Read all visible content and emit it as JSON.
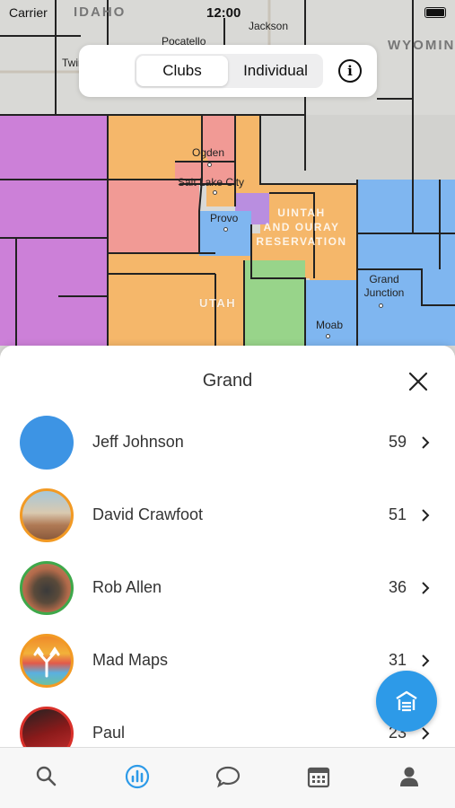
{
  "status_bar": {
    "carrier": "Carrier",
    "time": "12:00"
  },
  "map": {
    "state_labels": {
      "idaho": "IDAHO",
      "wyoming": "WYOMIN",
      "utah": "UTAH"
    },
    "reservation_label": [
      "UINTAH",
      "AND OURAY",
      "RESERVATION"
    ],
    "cities": [
      "Jackson",
      "Pocatello",
      "Twin",
      "Ogden",
      "Salt Lake City",
      "Provo",
      "Grand Junction",
      "Moab"
    ],
    "region_colors": {
      "purple": "#cc80d8",
      "orange": "#f5b76a",
      "red": "#f19a95",
      "blue": "#7fb6f0",
      "green": "#98d48a",
      "violet": "#b98ee0"
    }
  },
  "segmented_control": {
    "options": [
      "Clubs",
      "Individual"
    ],
    "selected": "Clubs",
    "info_icon": "info-icon"
  },
  "sheet": {
    "title": "Grand",
    "close_icon": "close-icon",
    "rows": [
      {
        "name": "Jeff Johnson",
        "score": "59",
        "avatar_color": "#3d94e4"
      },
      {
        "name": "David Crawfoot",
        "score": "51",
        "avatar_color": "#f29a24"
      },
      {
        "name": "Rob Allen",
        "score": "36",
        "avatar_color": "#3ea84a"
      },
      {
        "name": "Mad Maps",
        "score": "31",
        "avatar_color": "#f29a24"
      },
      {
        "name": "Paul",
        "score": "23",
        "avatar_color": "#d9302a"
      }
    ]
  },
  "fab": {
    "icon": "garage-icon",
    "color": "#2d9ae8"
  },
  "tabbar": {
    "items": [
      "search-icon",
      "leaderboard-icon",
      "chat-icon",
      "calendar-icon",
      "profile-icon"
    ],
    "selected": "leaderboard-icon",
    "active_color": "#2d9ae8"
  }
}
